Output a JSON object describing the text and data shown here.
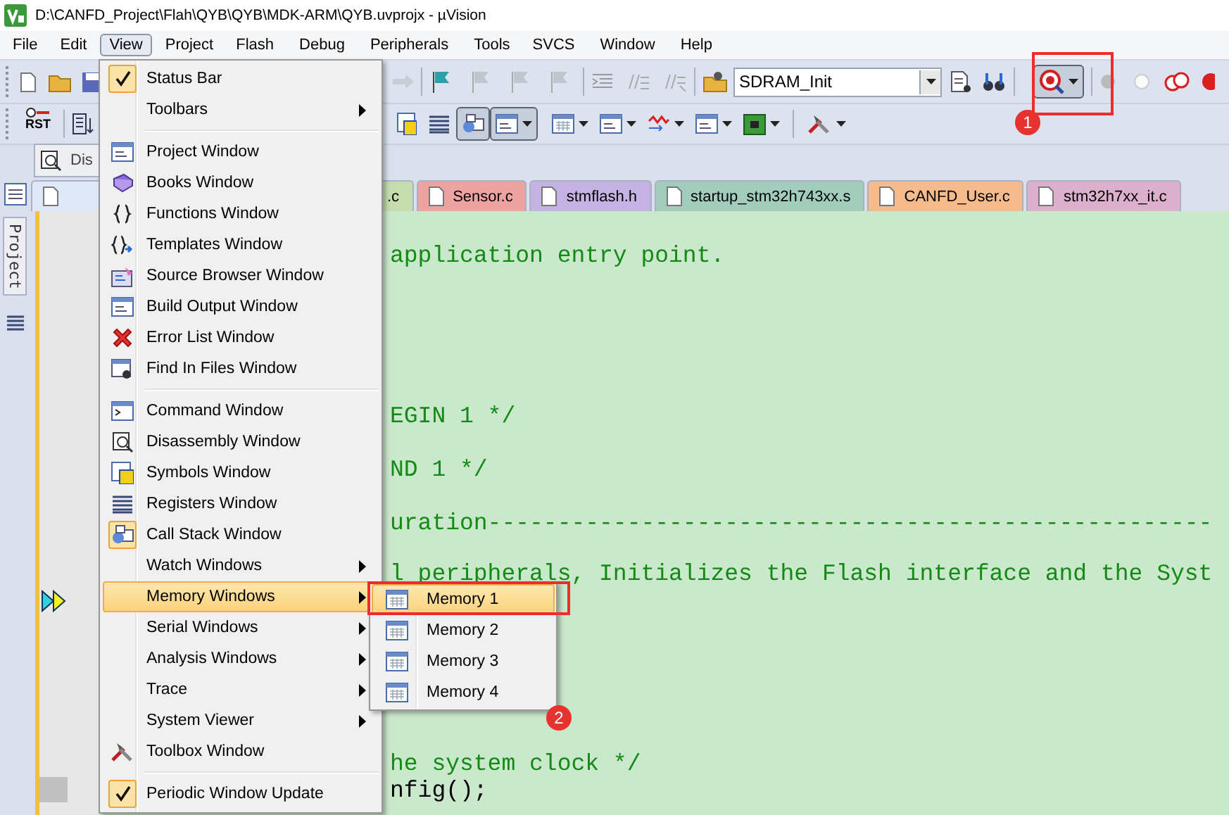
{
  "window": {
    "title": "D:\\CANFD_Project\\Flah\\QYB\\QYB\\MDK-ARM\\QYB.uvprojx - µVision"
  },
  "menu_bar": [
    {
      "label": "File",
      "selected": false
    },
    {
      "label": "Edit",
      "selected": false
    },
    {
      "label": "View",
      "selected": true
    },
    {
      "label": "Project",
      "selected": false
    },
    {
      "label": "Flash",
      "selected": false
    },
    {
      "label": "Debug",
      "selected": false
    },
    {
      "label": "Peripherals",
      "selected": false
    },
    {
      "label": "Tools",
      "selected": false
    },
    {
      "label": "SVCS",
      "selected": false
    },
    {
      "label": "Window",
      "selected": false
    },
    {
      "label": "Help",
      "selected": false
    }
  ],
  "toolbar": {
    "target_combo": {
      "value": "SDRAM_Init"
    },
    "debug_button": {
      "pressed": true
    },
    "reset_button": {
      "label": "RST"
    }
  },
  "side_tab": {
    "label": "Dis"
  },
  "side_panel": {
    "label": "Project"
  },
  "file_tabs": [
    {
      "label": ".c",
      "color": "#c4dcae"
    },
    {
      "label": "Sensor.c",
      "color": "#eea3a3"
    },
    {
      "label": "stmflash.h",
      "color": "#c4b2e2"
    },
    {
      "label": "startup_stm32h743xx.s",
      "color": "#a2cdbd"
    },
    {
      "label": "CANFD_User.c",
      "color": "#f5bb8c"
    },
    {
      "label": "stm32h7xx_it.c",
      "color": "#dcb0cc"
    }
  ],
  "code_lines": [
    {
      "text": "application entry point.",
      "kind": "comment"
    },
    {
      "text": "EGIN 1 */",
      "kind": "comment"
    },
    {
      "text": "ND 1 */",
      "kind": "comment"
    },
    {
      "text": "uration----------------------------------------------------",
      "kind": "comment"
    },
    {
      "text": "l peripherals, Initializes the Flash interface and the Syst",
      "kind": "comment"
    },
    {
      "text": "he system clock */",
      "kind": "comment"
    },
    {
      "text": "nfig();",
      "kind": "code"
    }
  ],
  "view_menu": {
    "sections": [
      [
        {
          "label": "Status Bar",
          "checked": true,
          "submenu": false,
          "selected": false
        },
        {
          "label": "Toolbars",
          "checked": false,
          "submenu": true,
          "selected": false
        }
      ],
      [
        {
          "label": "Project Window",
          "checked": false,
          "submenu": false,
          "selected": false
        },
        {
          "label": "Books Window",
          "checked": false,
          "submenu": false,
          "selected": false
        },
        {
          "label": "Functions Window",
          "checked": false,
          "submenu": false,
          "selected": false
        },
        {
          "label": "Templates Window",
          "checked": false,
          "submenu": false,
          "selected": false
        },
        {
          "label": "Source Browser Window",
          "checked": false,
          "submenu": false,
          "selected": false
        },
        {
          "label": "Build Output Window",
          "checked": false,
          "submenu": false,
          "selected": false
        },
        {
          "label": "Error List Window",
          "checked": false,
          "submenu": false,
          "selected": false
        },
        {
          "label": "Find In Files Window",
          "checked": false,
          "submenu": false,
          "selected": false
        }
      ],
      [
        {
          "label": "Command Window",
          "checked": false,
          "submenu": false,
          "selected": false
        },
        {
          "label": "Disassembly Window",
          "checked": false,
          "submenu": false,
          "selected": false
        },
        {
          "label": "Symbols Window",
          "checked": false,
          "submenu": false,
          "selected": false
        },
        {
          "label": "Registers Window",
          "checked": false,
          "submenu": false,
          "selected": false
        },
        {
          "label": "Call Stack Window",
          "checked": true,
          "submenu": false,
          "selected": false
        },
        {
          "label": "Watch Windows",
          "checked": false,
          "submenu": true,
          "selected": false
        },
        {
          "label": "Memory Windows",
          "checked": false,
          "submenu": true,
          "selected": true
        },
        {
          "label": "Serial Windows",
          "checked": false,
          "submenu": true,
          "selected": false
        },
        {
          "label": "Analysis Windows",
          "checked": false,
          "submenu": true,
          "selected": false
        },
        {
          "label": "Trace",
          "checked": false,
          "submenu": true,
          "selected": false
        },
        {
          "label": "System Viewer",
          "checked": false,
          "submenu": true,
          "selected": false
        },
        {
          "label": "Toolbox Window",
          "checked": false,
          "submenu": false,
          "selected": false
        }
      ],
      [
        {
          "label": "Periodic Window Update",
          "checked": true,
          "submenu": false,
          "selected": false
        }
      ]
    ]
  },
  "memory_submenu": [
    {
      "label": "Memory 1",
      "selected": true
    },
    {
      "label": "Memory 2",
      "selected": false
    },
    {
      "label": "Memory 3",
      "selected": false
    },
    {
      "label": "Memory 4",
      "selected": false
    }
  ],
  "annotations": [
    {
      "label": "1"
    },
    {
      "label": "2"
    }
  ]
}
